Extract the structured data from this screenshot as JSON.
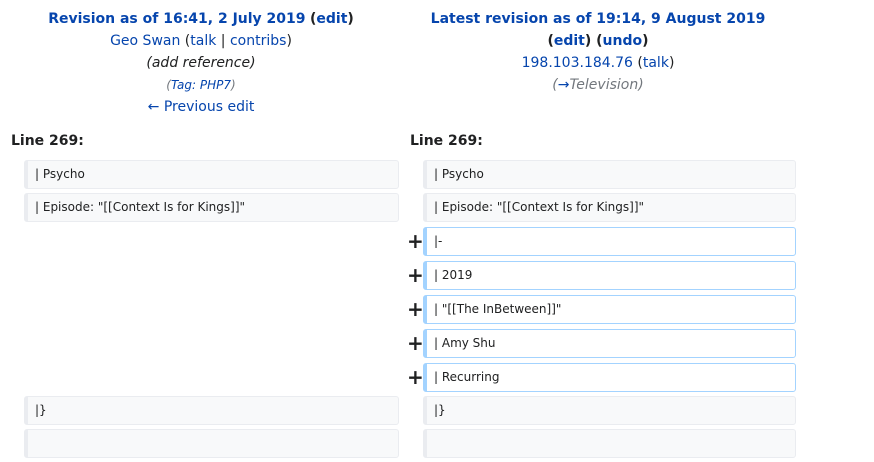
{
  "left": {
    "title": "Revision as of 16:41, 2 July 2019",
    "edit_label": "edit",
    "user": "Geo Swan",
    "talk_label": "talk",
    "contribs_label": "contribs",
    "summary": "(add reference)",
    "tag_label": "Tag:",
    "tag_value": "PHP7",
    "previous_edit_label": "← Previous edit"
  },
  "right": {
    "title": "Latest revision as of 19:14, 9 August 2019",
    "edit_label": "edit",
    "undo_label": "undo",
    "user": "198.103.184.76",
    "talk_label": "talk",
    "summary_arrow": "→",
    "summary_section": "Television"
  },
  "diff": {
    "left_line_label": "Line 269:",
    "right_line_label": "Line 269:",
    "added_marker": "+",
    "left_cells": [
      "| Psycho",
      "| Episode: \"[[Context Is for Kings]]\"",
      "|}",
      ""
    ],
    "right_cells": [
      "| Psycho",
      "| Episode: \"[[Context Is for Kings]]\"",
      "|}",
      ""
    ],
    "added_cells": [
      "|-",
      "| 2019",
      "| \"[[The InBetween]]\"",
      "| Amy Shu",
      "| Recurring"
    ]
  }
}
